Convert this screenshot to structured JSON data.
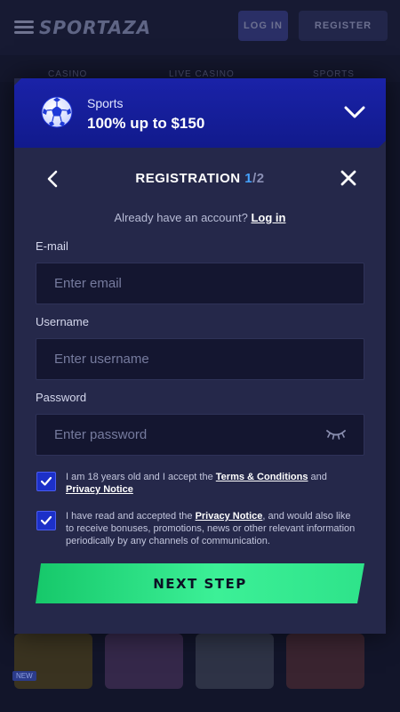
{
  "background": {
    "logo": "SPORTAZA",
    "login_label": "LOG IN",
    "register_label": "REGISTER",
    "tabs": [
      "CASINO",
      "LIVE CASINO",
      "SPORTS"
    ],
    "tile_badge": "NEW"
  },
  "bonus": {
    "icon": "soccer-ball-icon",
    "title": "Sports",
    "offer": "100% up to $150"
  },
  "registration": {
    "title": "REGISTRATION",
    "step_current": "1",
    "step_total": "/2",
    "already_text": "Already have an account?",
    "login_link": "Log in"
  },
  "form": {
    "email_label": "E-mail",
    "email_placeholder": "Enter email",
    "username_label": "Username",
    "username_placeholder": "Enter username",
    "password_label": "Password",
    "password_placeholder": "Enter password"
  },
  "consents": {
    "age_prefix": "I am 18 years old and I accept the",
    "age_terms_link": "Terms & Conditions",
    "age_and": "and",
    "age_privacy_link": "Privacy Notice",
    "age_checked": true,
    "marketing_prefix": "I have read and accepted the",
    "marketing_privacy_link": "Privacy Notice",
    "marketing_suffix": ", and would also like to receive bonuses, promotions, news or other relevant information periodically by any channels of communication.",
    "marketing_checked": true
  },
  "next_button": "NEXT STEP",
  "colors": {
    "accent_blue": "#1c30c8",
    "step_blue": "#45a3ff",
    "cta_green": "#2ee38a",
    "modal_bg": "#25284a"
  }
}
